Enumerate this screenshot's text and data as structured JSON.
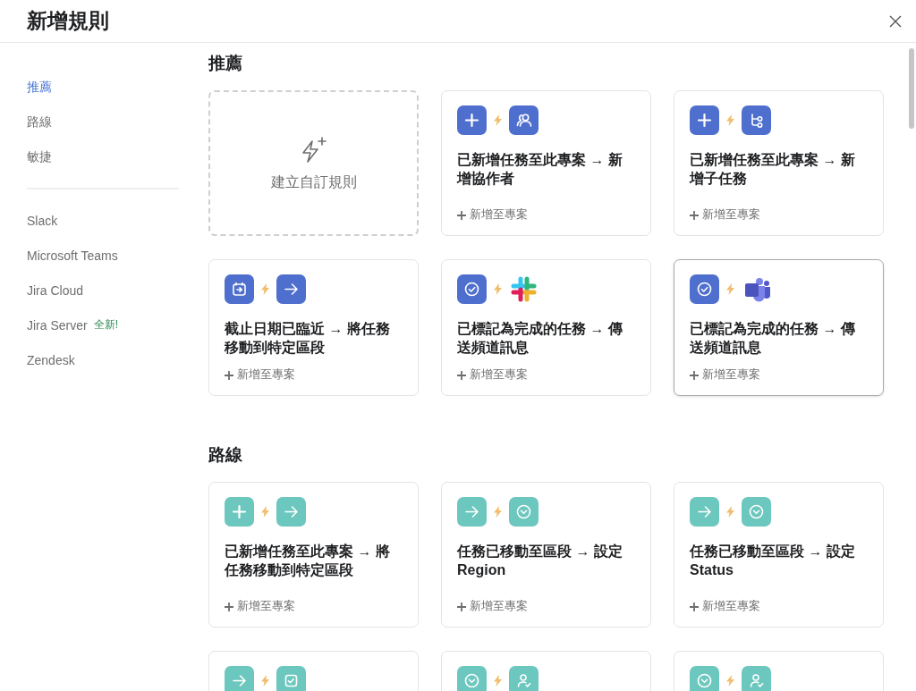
{
  "window": {
    "title": "新增規則"
  },
  "sidebar": {
    "items": [
      {
        "label": "推薦",
        "selected": true
      },
      {
        "label": "路線",
        "selected": false
      },
      {
        "label": "敏捷",
        "selected": false
      }
    ],
    "integrations": [
      {
        "label": "Slack",
        "selected": false
      },
      {
        "label": "Microsoft Teams",
        "selected": false
      },
      {
        "label": "Jira Cloud",
        "selected": false
      },
      {
        "label": "Jira Server",
        "selected": false,
        "badge": "全新!"
      },
      {
        "label": "Zendesk",
        "selected": false
      }
    ]
  },
  "sections": [
    {
      "title": "推薦",
      "cards": [
        {
          "kind": "custom",
          "label": "建立自訂規則"
        },
        {
          "kind": "rule",
          "hovered": false,
          "icons": [
            {
              "kind": "plus",
              "color": "#4f6fce"
            },
            {
              "kind": "people",
              "color": "#4f6fce"
            }
          ],
          "title": "已新增任務至此專案 → 新增協作者",
          "action": "新增至專案"
        },
        {
          "kind": "rule",
          "hovered": false,
          "icons": [
            {
              "kind": "plus",
              "color": "#4f6fce"
            },
            {
              "kind": "subtask",
              "color": "#4f6fce"
            }
          ],
          "title": "已新增任務至此專案 → 新增子任務",
          "action": "新增至專案"
        },
        {
          "kind": "rule",
          "hovered": false,
          "icons": [
            {
              "kind": "calendar",
              "color": "#4f6fce"
            },
            {
              "kind": "arrow",
              "color": "#4f6fce"
            }
          ],
          "title": "截止日期已臨近 → 將任務移動到特定區段",
          "action": "新增至專案"
        },
        {
          "kind": "rule",
          "hovered": false,
          "icons": [
            {
              "kind": "check",
              "color": "#4f6fce"
            },
            {
              "kind": "slack"
            }
          ],
          "title": "已標記為完成的任務 → 傳送頻道訊息",
          "action": "新增至專案"
        },
        {
          "kind": "rule",
          "hovered": true,
          "icons": [
            {
              "kind": "check",
              "color": "#4f6fce"
            },
            {
              "kind": "teams"
            }
          ],
          "title": "已標記為完成的任務 → 傳送頻道訊息",
          "action": "新增至專案"
        }
      ]
    },
    {
      "title": "路線",
      "cards": [
        {
          "kind": "rule",
          "hovered": false,
          "icons": [
            {
              "kind": "plus",
              "color": "#6cc7be"
            },
            {
              "kind": "arrow",
              "color": "#6cc7be"
            }
          ],
          "title": "已新增任務至此專案 → 將任務移動到特定區段",
          "action": "新增至專案"
        },
        {
          "kind": "rule",
          "hovered": false,
          "icons": [
            {
              "kind": "arrow",
              "color": "#6cc7be"
            },
            {
              "kind": "dropdown",
              "color": "#6cc7be"
            }
          ],
          "title": "任務已移動至區段 → 設定 Region",
          "action": "新增至專案"
        },
        {
          "kind": "rule",
          "hovered": false,
          "icons": [
            {
              "kind": "arrow",
              "color": "#6cc7be"
            },
            {
              "kind": "dropdown",
              "color": "#6cc7be"
            }
          ],
          "title": "任務已移動至區段 → 設定 Status",
          "action": "新增至專案"
        },
        {
          "kind": "rule",
          "hovered": false,
          "icons": [
            {
              "kind": "arrow",
              "color": "#6cc7be"
            },
            {
              "kind": "checkbox",
              "color": "#6cc7be"
            }
          ]
        },
        {
          "kind": "rule",
          "hovered": false,
          "icons": [
            {
              "kind": "dropdown",
              "color": "#6cc7be"
            },
            {
              "kind": "person",
              "color": "#6cc7be"
            }
          ]
        },
        {
          "kind": "rule",
          "hovered": false,
          "icons": [
            {
              "kind": "dropdown",
              "color": "#6cc7be"
            },
            {
              "kind": "person",
              "color": "#6cc7be"
            }
          ]
        }
      ]
    }
  ]
}
